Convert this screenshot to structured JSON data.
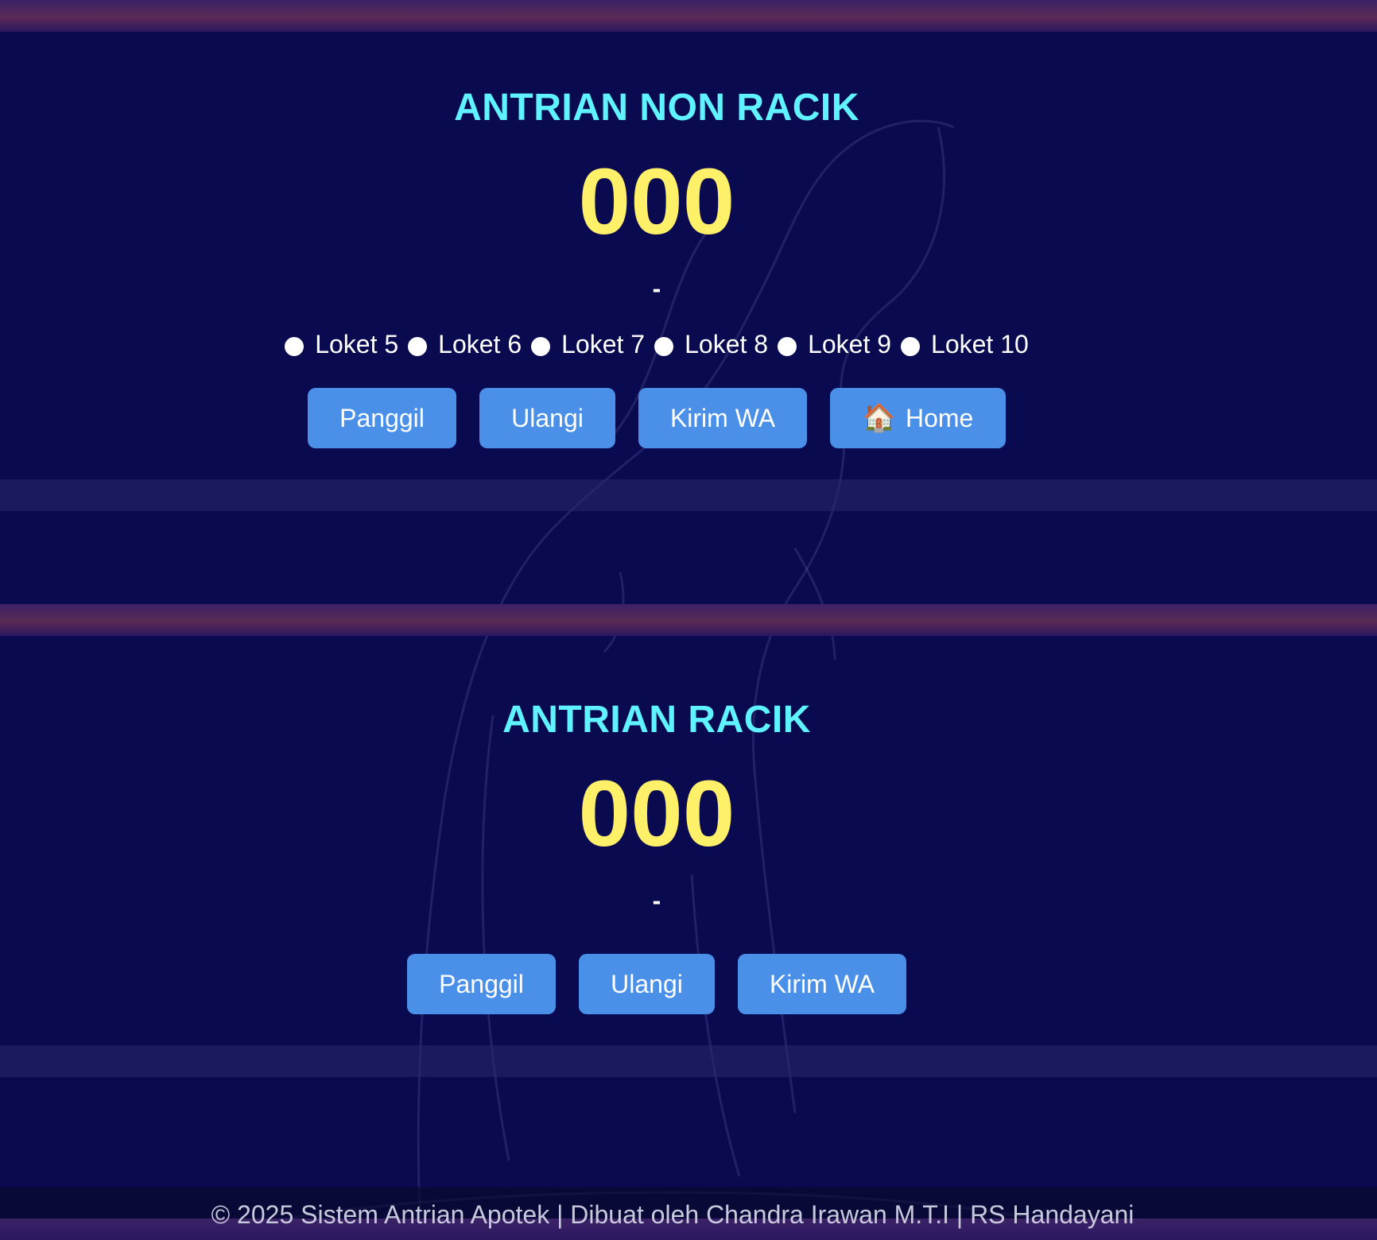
{
  "sections": [
    {
      "title": "ANTRIAN NON RACIK",
      "number": "000",
      "status": "-",
      "counters": [
        "Loket 5",
        "Loket 6",
        "Loket 7",
        "Loket 8",
        "Loket 9",
        "Loket 10"
      ],
      "buttons": {
        "call": "Panggil",
        "repeat": "Ulangi",
        "send_wa": "Kirim WA",
        "home": "Home",
        "home_icon": "🏠"
      }
    },
    {
      "title": "ANTRIAN RACIK",
      "number": "000",
      "status": "-",
      "buttons": {
        "call": "Panggil",
        "repeat": "Ulangi",
        "send_wa": "Kirim WA"
      }
    }
  ],
  "footer": {
    "text": "© 2025 Sistem Antrian Apotek | Dibuat oleh Chandra Irawan M.T.I | RS Handayani"
  },
  "colors": {
    "background": "#0a0a50",
    "title": "#5ff2ff",
    "number": "#fff06a",
    "button": "#4a8fe8"
  }
}
